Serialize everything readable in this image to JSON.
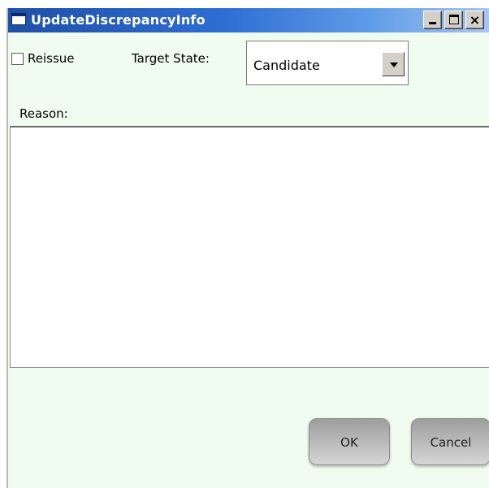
{
  "window": {
    "title": "UpdateDiscrepancyInfo",
    "controls": {
      "minimize": "minimize",
      "maximize": "maximize",
      "close": "×"
    }
  },
  "form": {
    "reissue": {
      "label": "Reissue",
      "checked": false
    },
    "target_state": {
      "label": "Target State:",
      "selected": "Candidate"
    },
    "reason": {
      "label": "Reason:",
      "value": ""
    }
  },
  "buttons": {
    "ok": "OK",
    "cancel": "Cancel"
  },
  "colors": {
    "titlebar": "#2f6ed3",
    "dialog_background": "#f0fcf0"
  }
}
